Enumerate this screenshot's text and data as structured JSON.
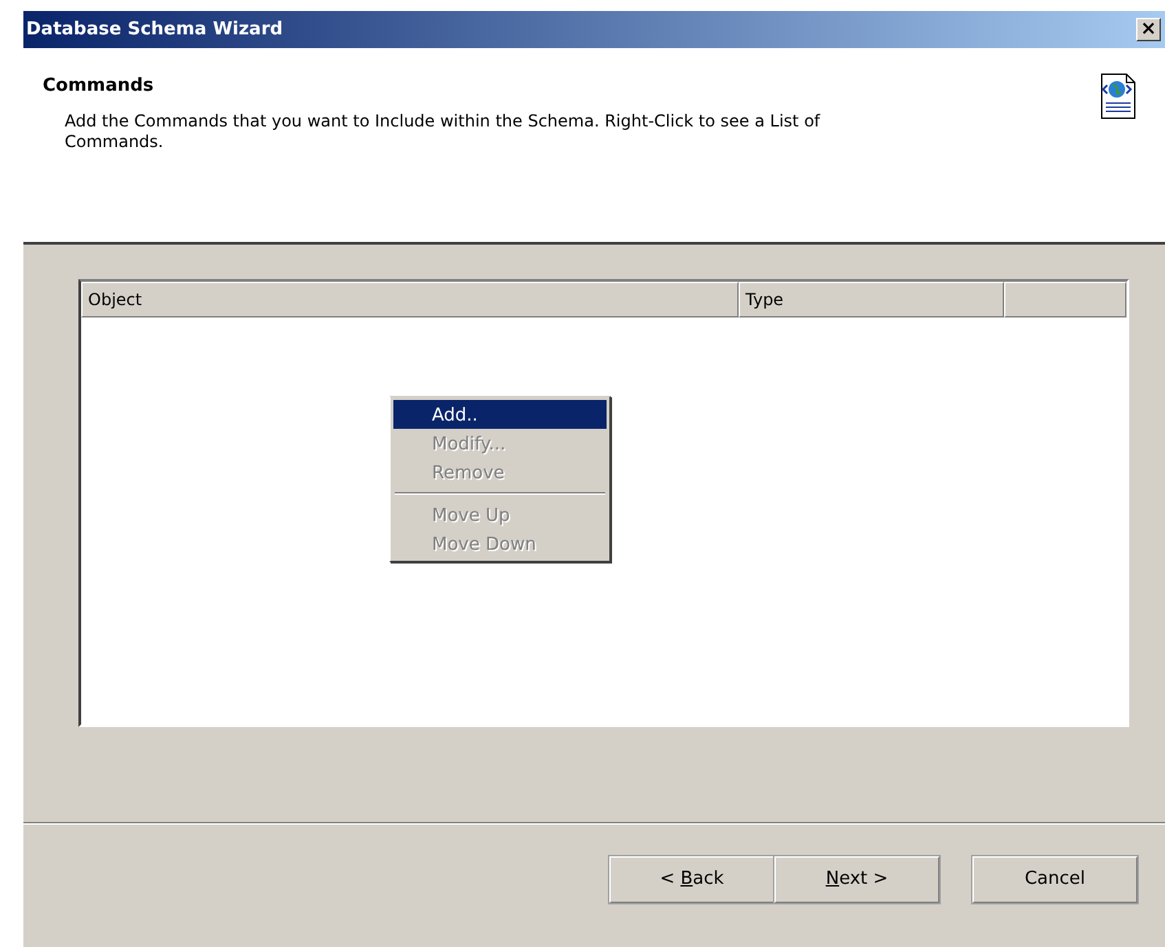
{
  "window": {
    "title": "Database Schema Wizard",
    "close": "×"
  },
  "header": {
    "title": "Commands",
    "description": "Add the Commands that you want to Include within the Schema. Right-Click to see a List of Commands."
  },
  "list": {
    "columns": [
      "Object",
      "Type"
    ]
  },
  "context_menu": [
    {
      "label": "Add..",
      "kind": "item",
      "selected": true,
      "disabled": false
    },
    {
      "label": "Modify...",
      "kind": "item",
      "selected": false,
      "disabled": true
    },
    {
      "label": "Remove",
      "kind": "item",
      "selected": false,
      "disabled": true
    },
    {
      "kind": "separator"
    },
    {
      "label": "Move Up",
      "kind": "item",
      "selected": false,
      "disabled": true
    },
    {
      "label": "Move Down",
      "kind": "item",
      "selected": false,
      "disabled": true
    }
  ],
  "buttons": [
    {
      "pre": "< ",
      "key": "B",
      "post": "ack"
    },
    {
      "key": "N",
      "post": "ext >"
    },
    {
      "pre": "Cancel"
    }
  ]
}
